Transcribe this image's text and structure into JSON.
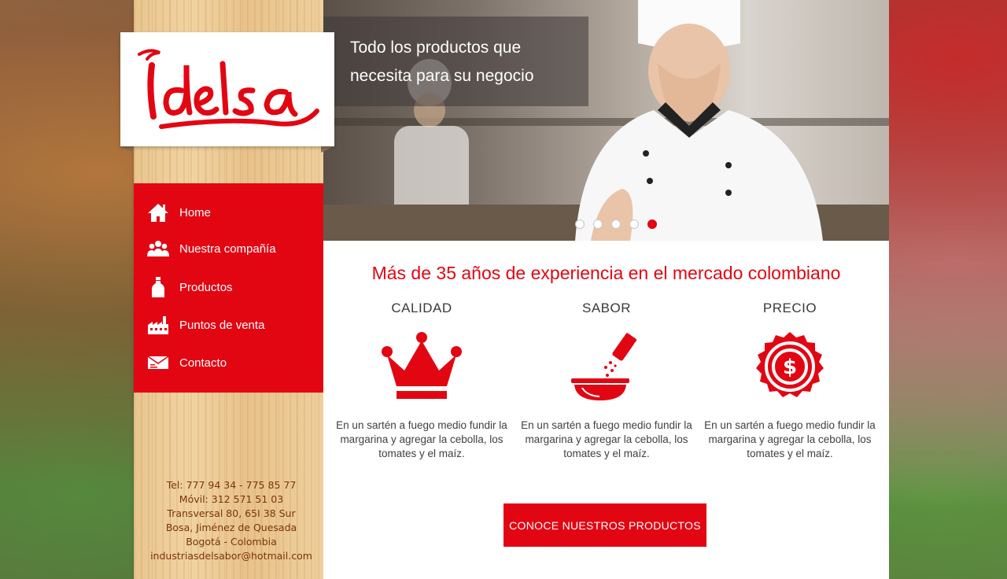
{
  "brand": {
    "logo_text": "Idelsa",
    "accent_color": "#e20613"
  },
  "hero": {
    "caption_line1": "Todo los productos que",
    "caption_line2": "necesita para su negocio",
    "slides_total": 5,
    "active_slide": 5
  },
  "nav": {
    "items": [
      {
        "label": "Home",
        "icon": "home-icon"
      },
      {
        "label": "Nuestra compañía",
        "icon": "people-icon"
      },
      {
        "label": "Productos",
        "icon": "bottle-icon"
      },
      {
        "label": "Puntos de venta",
        "icon": "factory-icon"
      },
      {
        "label": "Contacto",
        "icon": "envelope-icon"
      }
    ]
  },
  "contact": {
    "tel": "Tel: 777 94 34 - 775 85 77",
    "movil": "Móvil: 312 571 51 03",
    "address1": "Transversal 80, 65I 38 Sur",
    "address2": "Bosa, Jiménez de Quesada",
    "city": "Bogotá - Colombia",
    "email": "industriasdelsabor@hotmail.com"
  },
  "main": {
    "headline": "Más de 35 años de experiencia en el mercado colombiano",
    "features": [
      {
        "title": "CALIDAD",
        "icon": "crown-icon",
        "text": "En un sartén a fuego medio fundir la margarina y agregar la cebolla, los tomates y el maíz."
      },
      {
        "title": "SABOR",
        "icon": "mortar-salt-icon",
        "text": "En un sartén a fuego medio fundir la margarina y agregar la cebolla, los tomates y el maíz."
      },
      {
        "title": "PRECIO",
        "icon": "price-badge-icon",
        "text": "En un sartén a fuego medio fundir la margarina y agregar la cebolla, los tomates y el maíz."
      }
    ],
    "cta_label": "CONOCE NUESTROS PRODUCTOS"
  }
}
